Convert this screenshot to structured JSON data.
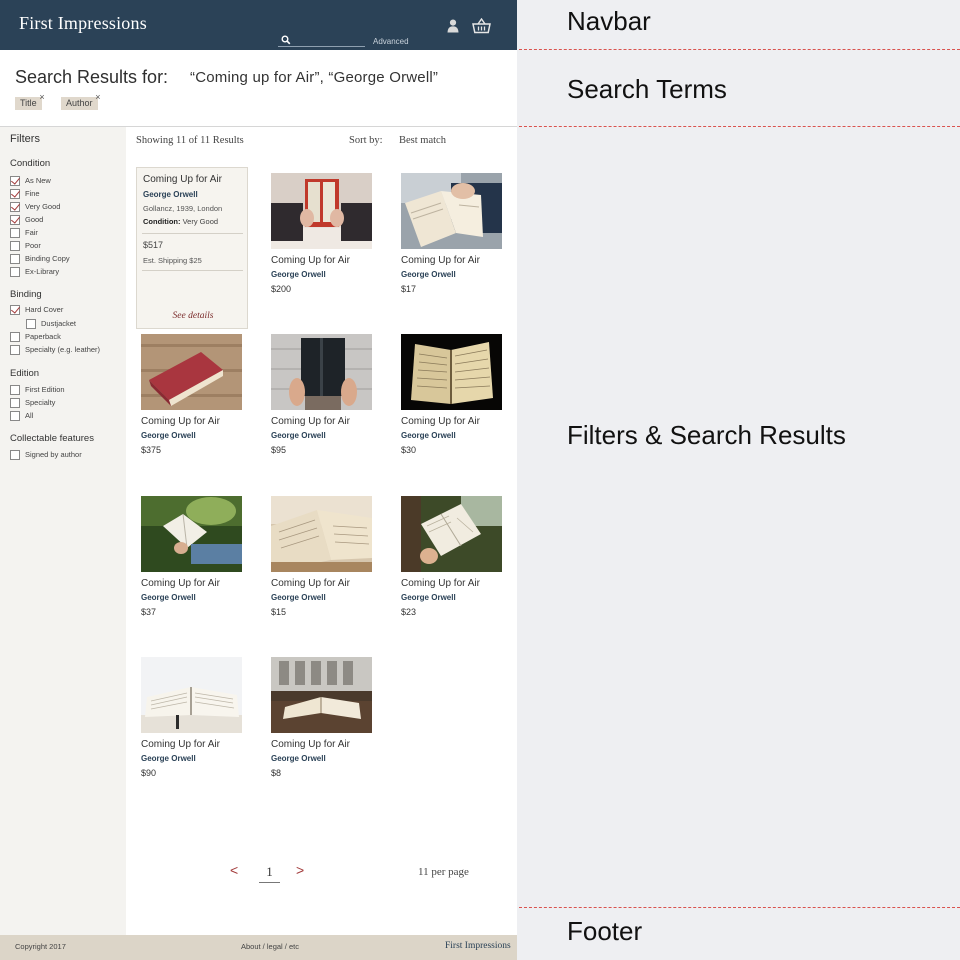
{
  "navbar": {
    "brand": "First Impressions",
    "search_placeholder": "",
    "advanced_label": "Advanced"
  },
  "search_terms": {
    "title": "Search Results for:",
    "query": "“Coming up for Air”, “George Orwell”",
    "chips": [
      "Title",
      "Author"
    ],
    "chip_remove": "×"
  },
  "filters": {
    "title": "Filters",
    "groups": [
      {
        "title": "Condition",
        "options": [
          {
            "label": "As New",
            "checked": true
          },
          {
            "label": "Fine",
            "checked": true
          },
          {
            "label": "Very Good",
            "checked": true
          },
          {
            "label": "Good",
            "checked": true
          },
          {
            "label": "Fair",
            "checked": false
          },
          {
            "label": "Poor",
            "checked": false
          },
          {
            "label": "Binding Copy",
            "checked": false
          },
          {
            "label": "Ex-Library",
            "checked": false
          }
        ]
      },
      {
        "title": "Binding",
        "options": [
          {
            "label": "Hard Cover",
            "checked": true
          },
          {
            "label": "Dustjacket",
            "checked": false
          },
          {
            "label": "Paperback",
            "checked": false
          },
          {
            "label": "Specialty (e.g. leather)",
            "checked": false
          }
        ]
      },
      {
        "title": "Edition",
        "options": [
          {
            "label": "First Edition",
            "checked": false
          },
          {
            "label": "Specialty",
            "checked": false
          },
          {
            "label": "All",
            "checked": false
          }
        ]
      },
      {
        "title": "Collectable features",
        "options": [
          {
            "label": "Signed by author",
            "checked": false
          }
        ]
      }
    ]
  },
  "results": {
    "showing": "Showing 11 of 11 Results",
    "sort_label": "Sort by:",
    "sort_value": "Best match",
    "featured": {
      "title": "Coming Up for Air",
      "author": "George Orwell",
      "publication": "Gollancz, 1939, London",
      "condition_label": "Condition:",
      "condition_value": "Very Good",
      "price": "$517",
      "shipping": "Est. Shipping $25",
      "details_link": "See details"
    },
    "items": [
      {
        "title": "Coming Up for Air",
        "author": "George Orwell",
        "price": "$200"
      },
      {
        "title": "Coming Up for Air",
        "author": "George Orwell",
        "price": "$17"
      },
      {
        "title": "Coming Up for Air",
        "author": "George Orwell",
        "price": "$375"
      },
      {
        "title": "Coming Up for Air",
        "author": "George Orwell",
        "price": "$95"
      },
      {
        "title": "Coming Up for Air",
        "author": "George Orwell",
        "price": "$30"
      },
      {
        "title": "Coming Up for Air",
        "author": "George Orwell",
        "price": "$37"
      },
      {
        "title": "Coming Up for Air",
        "author": "George Orwell",
        "price": "$15"
      },
      {
        "title": "Coming Up for Air",
        "author": "George Orwell",
        "price": "$23"
      },
      {
        "title": "Coming Up for Air",
        "author": "George Orwell",
        "price": "$90"
      },
      {
        "title": "Coming Up for Air",
        "author": "George Orwell",
        "price": "$8"
      }
    ]
  },
  "pagination": {
    "prev": "<",
    "page": "1",
    "next": ">",
    "per_page": "11 per page"
  },
  "footer": {
    "copyright": "Copyright 2017",
    "links": "About / legal / etc",
    "brand": "First Impressions"
  },
  "annotations": {
    "navbar": "Navbar",
    "search_terms": "Search Terms",
    "filters_results": "Filters & Search Results",
    "footer": "Footer"
  },
  "colors": {
    "navbar_bg": "#2b4257",
    "footer_bg": "#dcd5c8",
    "accent_red": "#a23a3a",
    "annotation_line": "#d9534f"
  }
}
